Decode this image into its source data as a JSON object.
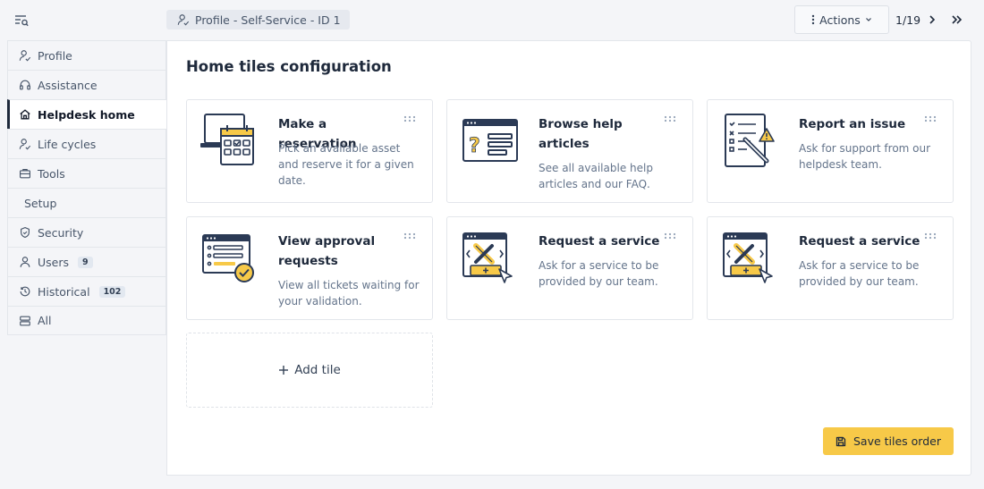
{
  "breadcrumb": {
    "label": "Profile - Self-Service - ID 1"
  },
  "header": {
    "actions_label": "Actions",
    "pager": "1/19"
  },
  "sidebar": {
    "items": [
      {
        "label": "Profile",
        "icon": "profile-icon"
      },
      {
        "label": "Assistance",
        "icon": "headset-icon"
      },
      {
        "label": "Helpdesk home",
        "icon": "home-icon",
        "active": true
      },
      {
        "label": "Life cycles",
        "icon": "lifecycle-icon"
      },
      {
        "label": "Tools",
        "icon": "briefcase-icon"
      },
      {
        "label": "Setup",
        "section": true
      },
      {
        "label": "Security",
        "icon": "shield-icon"
      },
      {
        "label": "Users",
        "icon": "user-icon",
        "count": "9"
      },
      {
        "label": "Historical",
        "icon": "history-icon",
        "count": "102"
      },
      {
        "label": "All",
        "icon": "list-icon"
      }
    ]
  },
  "main": {
    "title": "Home tiles configuration",
    "tiles": [
      {
        "title": "Make a reservation",
        "description": "Pick an available asset and reserve it for a given date.",
        "illustration": "calendar-reservation-illustration"
      },
      {
        "title": "Browse help articles",
        "description": "See all available help articles and our FAQ.",
        "illustration": "help-articles-illustration"
      },
      {
        "title": "Report an issue",
        "description": "Ask for support from our helpdesk team.",
        "illustration": "report-issue-illustration"
      },
      {
        "title": "View approval requests",
        "description": "View all tickets waiting for your validation.",
        "illustration": "approval-requests-illustration"
      },
      {
        "title": "Request a service",
        "description": "Ask for a service to be provided by our team.",
        "illustration": "request-service-illustration"
      },
      {
        "title": "Request a service",
        "description": "Ask for a service to be provided by our team.",
        "illustration": "request-service-illustration"
      }
    ],
    "add_tile_label": "Add tile",
    "save_label": "Save tiles order"
  },
  "colors": {
    "accent": "#f7c948",
    "navy": "#2b3a55",
    "background": "#f4f5f8"
  }
}
